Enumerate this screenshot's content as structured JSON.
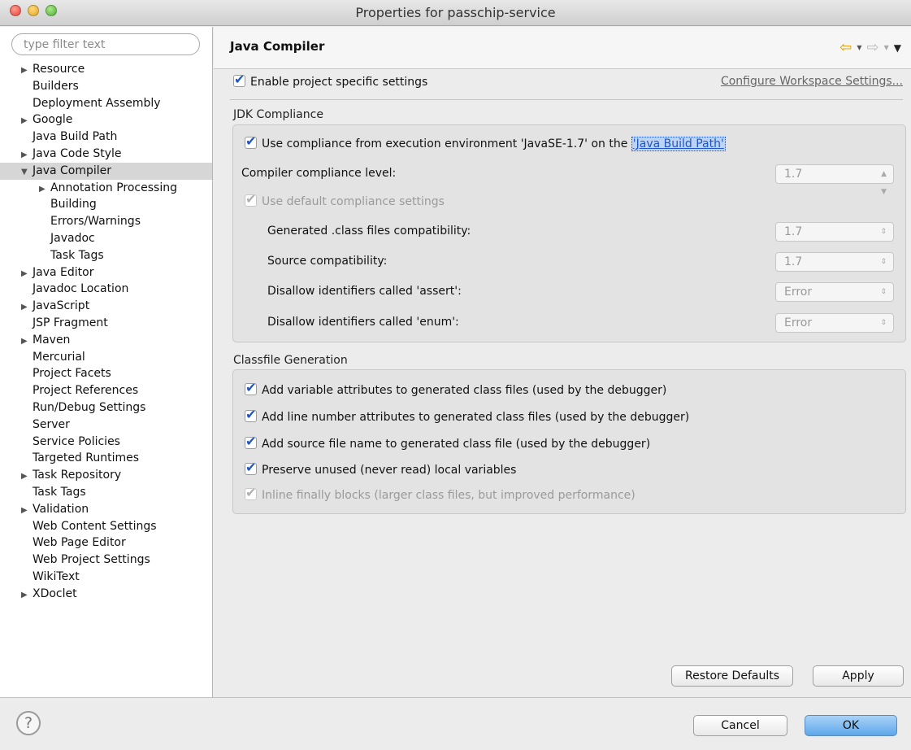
{
  "window": {
    "title": "Properties for passchip-service"
  },
  "filter": {
    "placeholder": "type filter text"
  },
  "tree": [
    {
      "label": "Resource",
      "expander": "▶",
      "indent": 0
    },
    {
      "label": "Builders",
      "expander": "",
      "indent": 0
    },
    {
      "label": "Deployment Assembly",
      "expander": "",
      "indent": 0
    },
    {
      "label": "Google",
      "expander": "▶",
      "indent": 0
    },
    {
      "label": "Java Build Path",
      "expander": "",
      "indent": 0
    },
    {
      "label": "Java Code Style",
      "expander": "▶",
      "indent": 0
    },
    {
      "label": "Java Compiler",
      "expander": "▼",
      "indent": 0,
      "selected": true
    },
    {
      "label": "Annotation Processing",
      "expander": "▶",
      "indent": 1
    },
    {
      "label": "Building",
      "expander": "",
      "indent": 1
    },
    {
      "label": "Errors/Warnings",
      "expander": "",
      "indent": 1
    },
    {
      "label": "Javadoc",
      "expander": "",
      "indent": 1
    },
    {
      "label": "Task Tags",
      "expander": "",
      "indent": 1
    },
    {
      "label": "Java Editor",
      "expander": "▶",
      "indent": 0
    },
    {
      "label": "Javadoc Location",
      "expander": "",
      "indent": 0
    },
    {
      "label": "JavaScript",
      "expander": "▶",
      "indent": 0
    },
    {
      "label": "JSP Fragment",
      "expander": "",
      "indent": 0
    },
    {
      "label": "Maven",
      "expander": "▶",
      "indent": 0
    },
    {
      "label": "Mercurial",
      "expander": "",
      "indent": 0
    },
    {
      "label": "Project Facets",
      "expander": "",
      "indent": 0
    },
    {
      "label": "Project References",
      "expander": "",
      "indent": 0
    },
    {
      "label": "Run/Debug Settings",
      "expander": "",
      "indent": 0
    },
    {
      "label": "Server",
      "expander": "",
      "indent": 0
    },
    {
      "label": "Service Policies",
      "expander": "",
      "indent": 0
    },
    {
      "label": "Targeted Runtimes",
      "expander": "",
      "indent": 0
    },
    {
      "label": "Task Repository",
      "expander": "▶",
      "indent": 0
    },
    {
      "label": "Task Tags",
      "expander": "",
      "indent": 0
    },
    {
      "label": "Validation",
      "expander": "▶",
      "indent": 0
    },
    {
      "label": "Web Content Settings",
      "expander": "",
      "indent": 0
    },
    {
      "label": "Web Page Editor",
      "expander": "",
      "indent": 0
    },
    {
      "label": "Web Project Settings",
      "expander": "",
      "indent": 0
    },
    {
      "label": "WikiText",
      "expander": "",
      "indent": 0
    },
    {
      "label": "XDoclet",
      "expander": "▶",
      "indent": 0
    }
  ],
  "page": {
    "title": "Java Compiler",
    "enable_label": "Enable project specific settings",
    "configure_link": "Configure Workspace Settings..."
  },
  "jdk": {
    "group_label": "JDK Compliance",
    "use_env_prefix": "Use compliance from execution environment 'JavaSE-1.7' on the ",
    "use_env_link": "'Java Build Path'",
    "compliance_label": "Compiler compliance level:",
    "compliance_value": "1.7",
    "default_label": "Use default compliance settings",
    "generated_label": "Generated .class files compatibility:",
    "generated_value": "1.7",
    "source_label": "Source compatibility:",
    "source_value": "1.7",
    "assert_label": "Disallow identifiers called 'assert':",
    "assert_value": "Error",
    "enum_label": "Disallow identifiers called 'enum':",
    "enum_value": "Error"
  },
  "classfile": {
    "group_label": "Classfile Generation",
    "variable_attrs": "Add variable attributes to generated class files (used by the debugger)",
    "line_numbers": "Add line number attributes to generated class files (used by the debugger)",
    "source_file": "Add source file name to generated class file (used by the debugger)",
    "preserve_unused": "Preserve unused (never read) local variables",
    "inline_finally": "Inline finally blocks (larger class files, but improved performance)"
  },
  "buttons": {
    "restore_defaults": "Restore Defaults",
    "apply": "Apply",
    "cancel": "Cancel",
    "ok": "OK"
  },
  "footer": {
    "help_glyph": "?"
  },
  "colors": {
    "link": "#1f56c4",
    "ok_button": "#5ea7ea",
    "selection": "#d6d6d6"
  }
}
